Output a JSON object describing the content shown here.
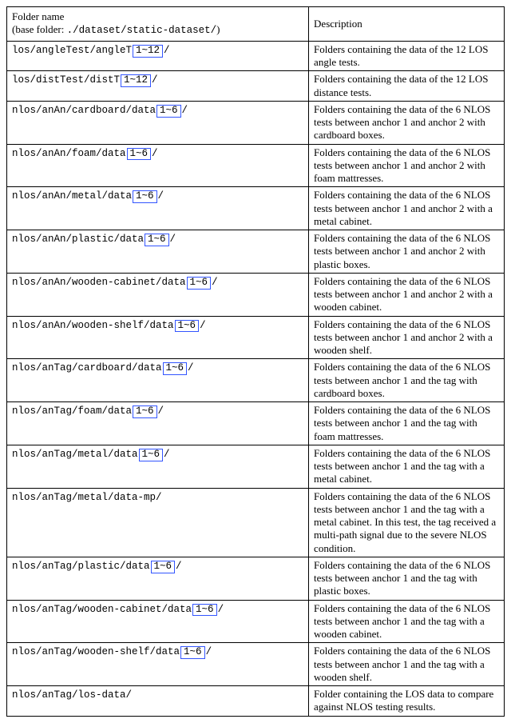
{
  "header": {
    "col1_line1": "Folder name",
    "col1_line2_pre": "(base folder: ",
    "col1_line2_path": "./dataset/static-dataset/",
    "col1_line2_post": ")",
    "col2": "Description"
  },
  "rows": [
    {
      "path_pre": "los/angleTest/angleT",
      "range": "1~12",
      "path_post": "/",
      "desc": "Folders containing the data of the 12 LOS angle tests."
    },
    {
      "path_pre": "los/distTest/distT",
      "range": "1~12",
      "path_post": "/",
      "desc": "Folders containing the data of the 12 LOS distance tests."
    },
    {
      "path_pre": "nlos/anAn/cardboard/data",
      "range": "1~6",
      "path_post": "/",
      "desc": "Folders containing the data of the 6 NLOS tests between anchor 1 and anchor 2 with cardboard boxes."
    },
    {
      "path_pre": "nlos/anAn/foam/data",
      "range": "1~6",
      "path_post": "/",
      "desc": "Folders containing the data of the 6 NLOS tests between anchor 1 and anchor 2 with foam mattresses."
    },
    {
      "path_pre": "nlos/anAn/metal/data",
      "range": "1~6",
      "path_post": "/",
      "desc": "Folders containing the data of the 6 NLOS tests between anchor 1 and anchor 2 with a metal cabinet."
    },
    {
      "path_pre": "nlos/anAn/plastic/data",
      "range": "1~6",
      "path_post": "/",
      "desc": "Folders containing the data of the 6 NLOS tests between anchor 1 and anchor 2 with plastic boxes."
    },
    {
      "path_pre": "nlos/anAn/wooden-cabinet/data",
      "range": "1~6",
      "path_post": "/",
      "desc": "Folders containing the data of the 6 NLOS tests between anchor 1 and anchor 2 with a wooden cabinet."
    },
    {
      "path_pre": "nlos/anAn/wooden-shelf/data",
      "range": "1~6",
      "path_post": "/",
      "desc": "Folders containing the data of the 6 NLOS tests between anchor 1 and anchor 2 with a wooden shelf."
    },
    {
      "path_pre": "nlos/anTag/cardboard/data",
      "range": "1~6",
      "path_post": "/",
      "desc": "Folders containing the data of the 6 NLOS tests between anchor 1 and the tag with cardboard boxes."
    },
    {
      "path_pre": "nlos/anTag/foam/data",
      "range": "1~6",
      "path_post": "/",
      "desc": "Folders containing the data of the 6 NLOS tests between anchor 1 and the tag with foam mattresses."
    },
    {
      "path_pre": "nlos/anTag/metal/data",
      "range": "1~6",
      "path_post": "/",
      "desc": "Folders containing the data of the 6 NLOS tests between anchor 1 and the tag with a metal cabinet."
    },
    {
      "path_pre": "nlos/anTag/metal/data-mp/",
      "range": null,
      "path_post": "",
      "desc": "Folders containing the data of the 6 NLOS tests between anchor 1 and the tag with a metal cabinet. In this test, the tag received a multi-path signal due to the severe NLOS condition."
    },
    {
      "path_pre": "nlos/anTag/plastic/data",
      "range": "1~6",
      "path_post": "/",
      "desc": "Folders containing the data of the 6 NLOS tests between anchor 1 and the tag with plastic boxes."
    },
    {
      "path_pre": "nlos/anTag/wooden-cabinet/data",
      "range": "1~6",
      "path_post": "/",
      "desc": "Folders containing the data of the 6 NLOS tests between anchor 1 and the tag with a wooden cabinet."
    },
    {
      "path_pre": "nlos/anTag/wooden-shelf/data",
      "range": "1~6",
      "path_post": "/",
      "desc": "Folders containing the data of the 6 NLOS tests between anchor 1 and the tag with a wooden shelf."
    },
    {
      "path_pre": "nlos/anTag/los-data/",
      "range": null,
      "path_post": "",
      "desc": "Folder containing the LOS data to compare against NLOS testing results."
    }
  ]
}
